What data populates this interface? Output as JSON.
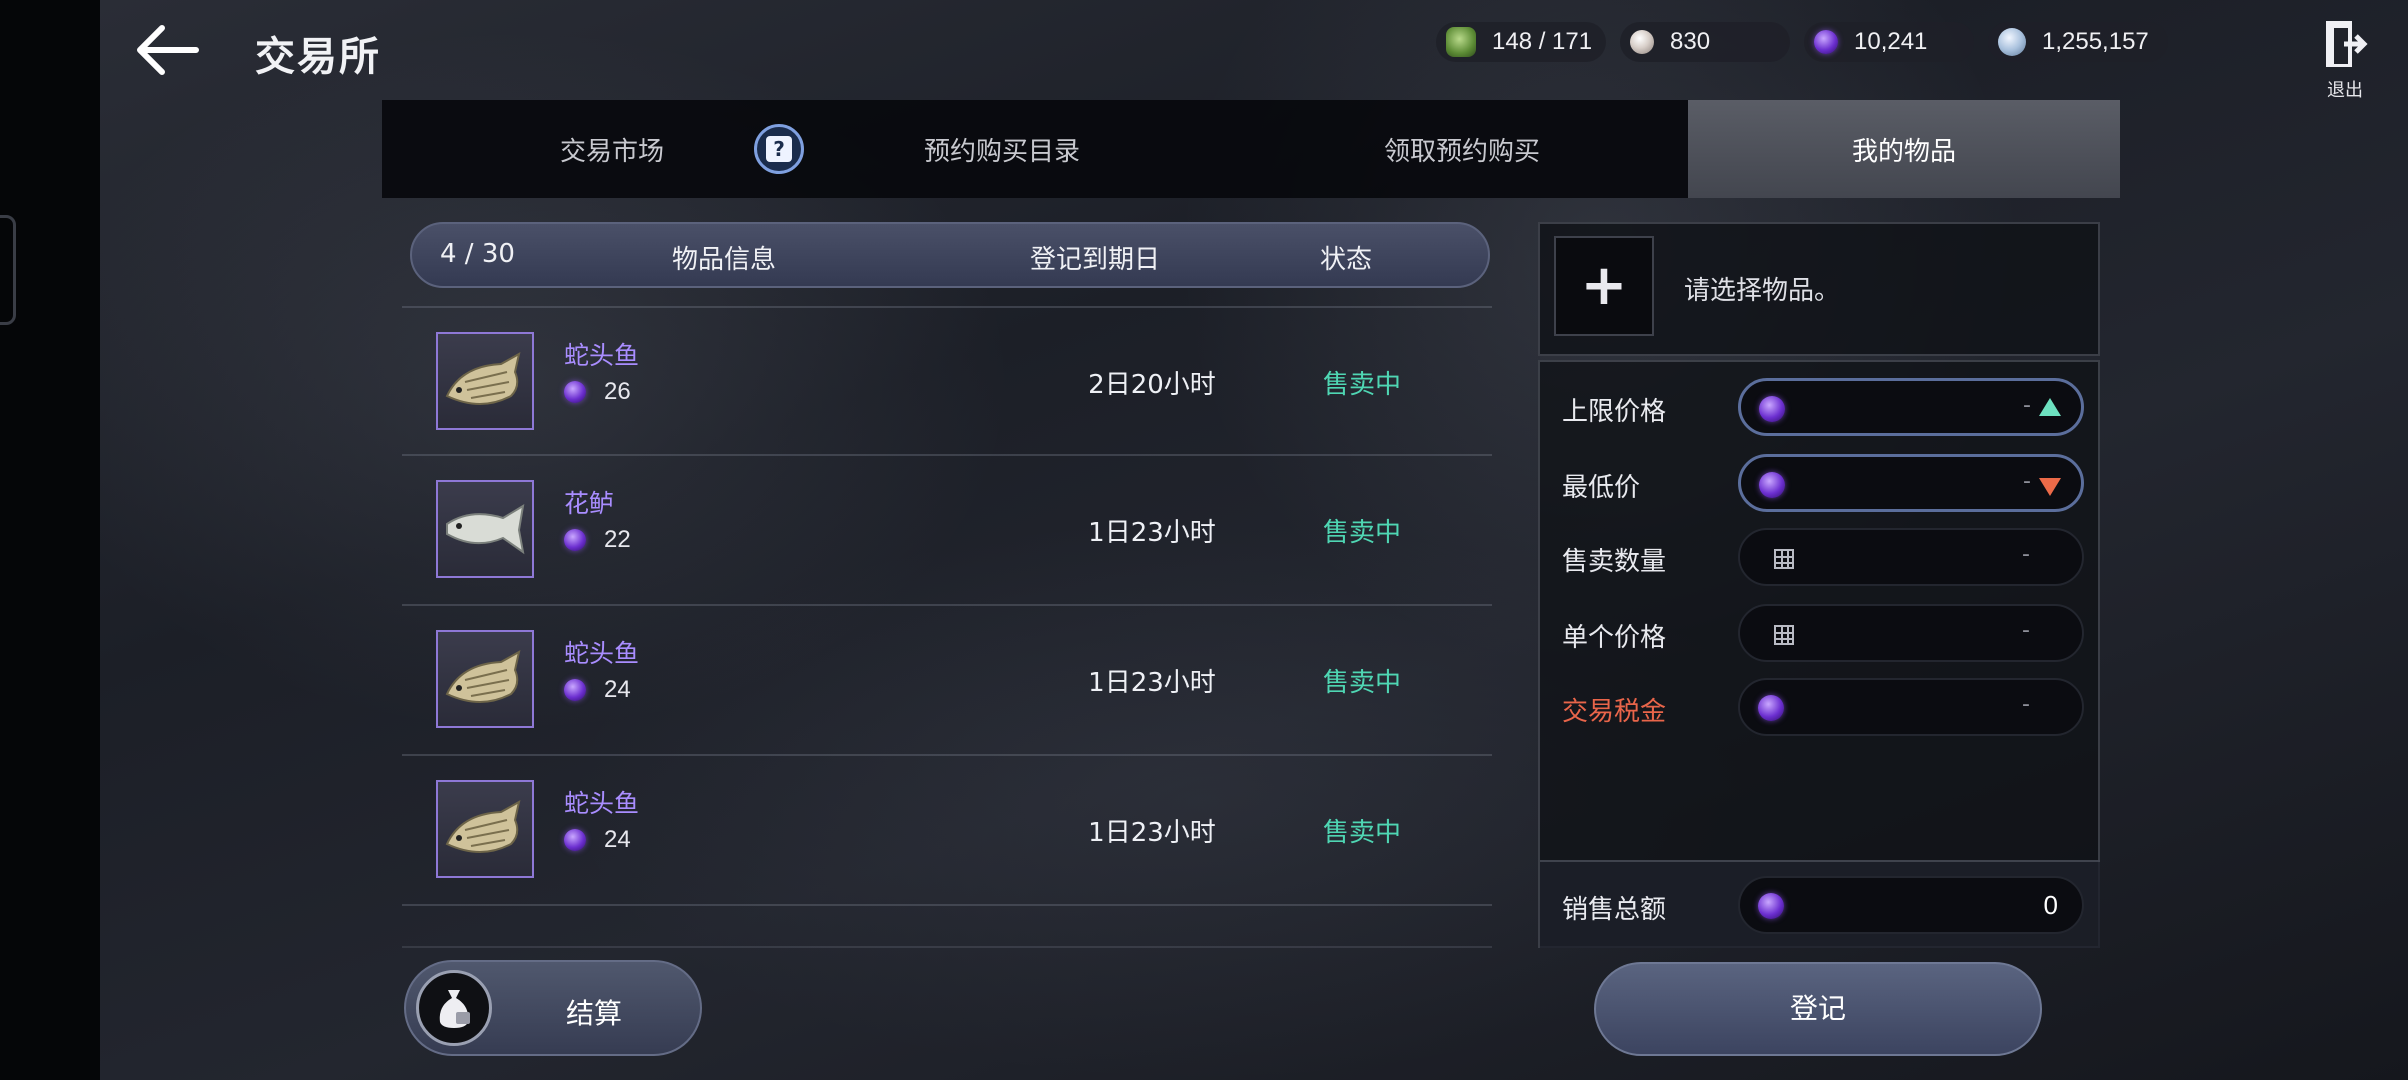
{
  "header": {
    "title": "交易所",
    "exit_label": "退出"
  },
  "currencies": [
    {
      "icon": "energy-icon",
      "value": "148 / 171"
    },
    {
      "icon": "pearl-icon",
      "value": "830"
    },
    {
      "icon": "purple-orb-icon",
      "value": "10,241"
    },
    {
      "icon": "silver-coin-icon",
      "value": "1,255,157"
    }
  ],
  "tabs": [
    {
      "label": "交易市场",
      "active": false
    },
    {
      "label": "预约购买目录",
      "active": false
    },
    {
      "label": "领取预约购买",
      "active": false
    },
    {
      "label": "我的物品",
      "active": true
    }
  ],
  "list": {
    "count": "4 / 30",
    "col_item": "物品信息",
    "col_date": "登记到期日",
    "col_status": "状态",
    "rows": [
      {
        "name": "蛇头鱼",
        "price": "26",
        "date": "2日20小时",
        "status": "售卖中",
        "icon": "snakehead-fish-icon"
      },
      {
        "name": "花鲈",
        "price": "22",
        "date": "1日23小时",
        "status": "售卖中",
        "icon": "sea-bass-icon"
      },
      {
        "name": "蛇头鱼",
        "price": "24",
        "date": "1日23小时",
        "status": "售卖中",
        "icon": "snakehead-fish-icon"
      },
      {
        "name": "蛇头鱼",
        "price": "24",
        "date": "1日23小时",
        "status": "售卖中",
        "icon": "snakehead-fish-icon"
      }
    ]
  },
  "settle_label": "结算",
  "panel": {
    "select_hint": "请选择物品。",
    "max_price_label": "上限价格",
    "min_price_label": "最低价",
    "quantity_label": "售卖数量",
    "unit_price_label": "单个价格",
    "tax_label": "交易税金",
    "total_label": "销售总额",
    "empty_value": "-",
    "total_value": "0"
  },
  "register_label": "登记",
  "colors": {
    "status_selling": "#4fd6b3",
    "item_name": "#a98dff",
    "tax_label": "#e9654a",
    "arrow_up": "#6de1c0",
    "arrow_down": "#ec6a48"
  }
}
